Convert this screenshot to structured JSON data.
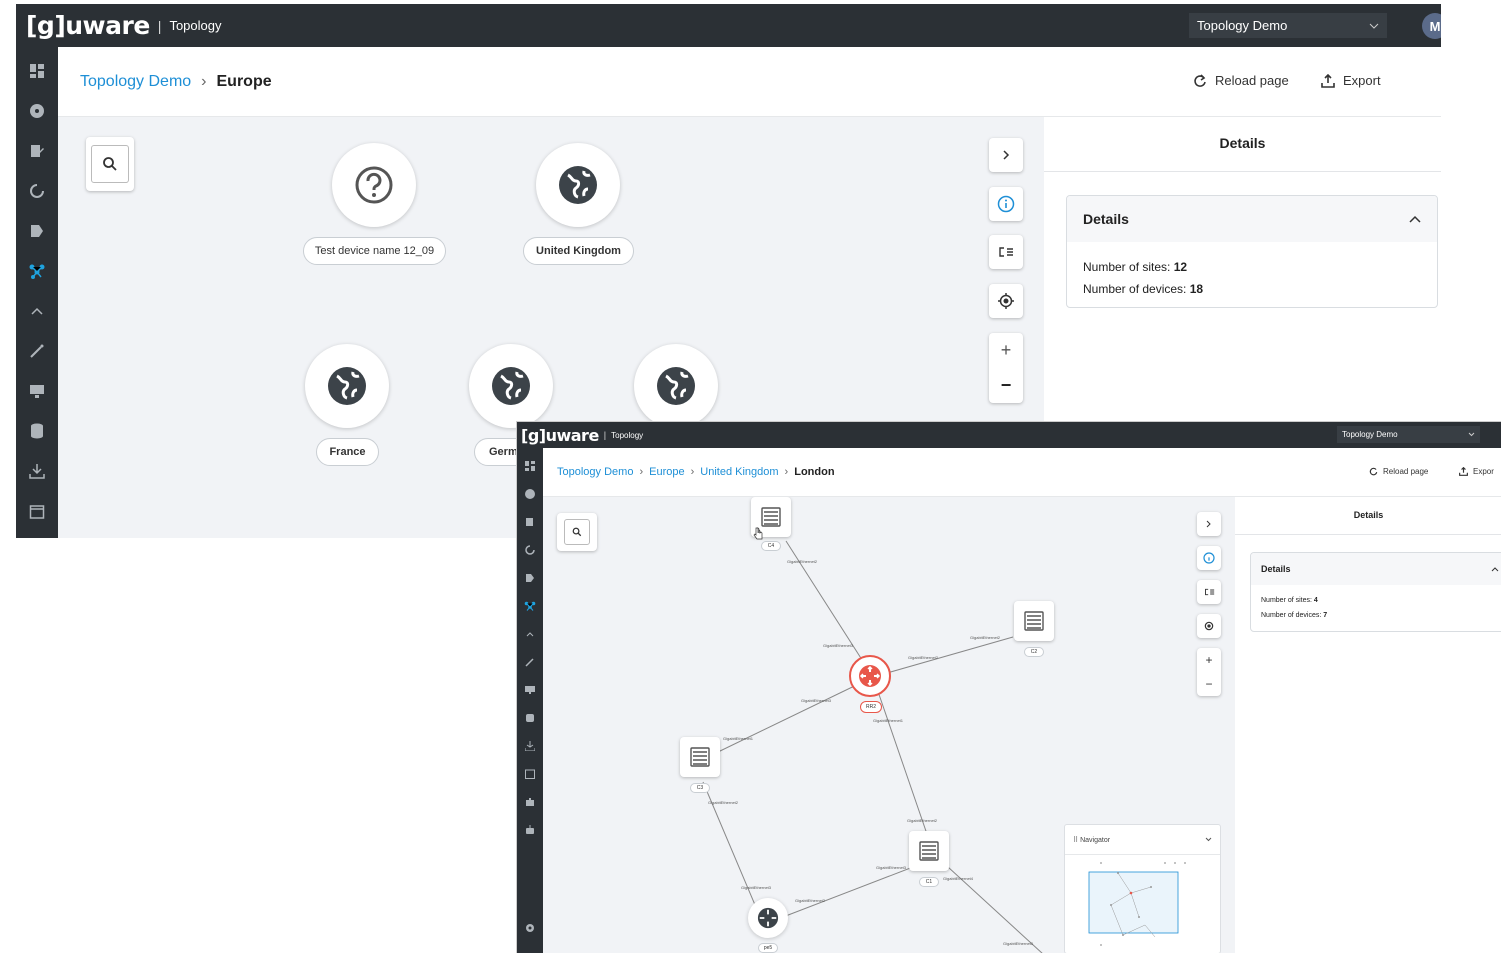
{
  "back": {
    "app": {
      "logo": "[g]uware",
      "separator": "|",
      "module": "Topology",
      "project": "Topology Demo",
      "avatar": "M"
    },
    "breadcrumb": {
      "root": "Topology Demo",
      "current": "Europe",
      "chevron": "›"
    },
    "actions": {
      "reload": "Reload page",
      "export": "Export"
    },
    "nodes": [
      {
        "label": "Test device name 12_09",
        "icon": "question-icon"
      },
      {
        "label": "United Kingdom",
        "icon": "globe-icon"
      },
      {
        "label": "France",
        "icon": "globe-icon"
      },
      {
        "label": "Germ",
        "icon": "globe-icon"
      },
      {
        "label": "",
        "icon": "globe-icon"
      }
    ],
    "zoom": {
      "plus": "+",
      "minus": "−"
    },
    "details": {
      "panel_title": "Details",
      "card_title": "Details",
      "sites_label": "Number of sites:",
      "sites_value": "12",
      "devices_label": "Number of devices:",
      "devices_value": "18"
    }
  },
  "front": {
    "app": {
      "logo": "[g]uware",
      "separator": "|",
      "module": "Topology",
      "project": "Topology Demo"
    },
    "breadcrumb": {
      "items": [
        "Topology Demo",
        "Europe",
        "United Kingdom"
      ],
      "current": "London",
      "chevron": "›"
    },
    "actions": {
      "reload": "Reload page",
      "export": "Expor"
    },
    "devices": [
      {
        "label": "C4",
        "type": "server"
      },
      {
        "label": "C2",
        "type": "server"
      },
      {
        "label": "RR2",
        "type": "router"
      },
      {
        "label": "C3",
        "type": "server"
      },
      {
        "label": "C1",
        "type": "server"
      },
      {
        "label": "pe5",
        "type": "router"
      }
    ],
    "zoom": {
      "plus": "+",
      "minus": "−"
    },
    "navigator": {
      "title": "Navigator"
    },
    "details": {
      "panel_title": "Details",
      "card_title": "Details",
      "sites_label": "Number of sites:",
      "sites_value": "4",
      "devices_label": "Number of devices:",
      "devices_value": "7"
    }
  },
  "colors": {
    "topbar": "#2b3035",
    "accent": "#1e8fd6",
    "canvas": "#f1f3f6",
    "router_highlight": "#e8574a"
  }
}
